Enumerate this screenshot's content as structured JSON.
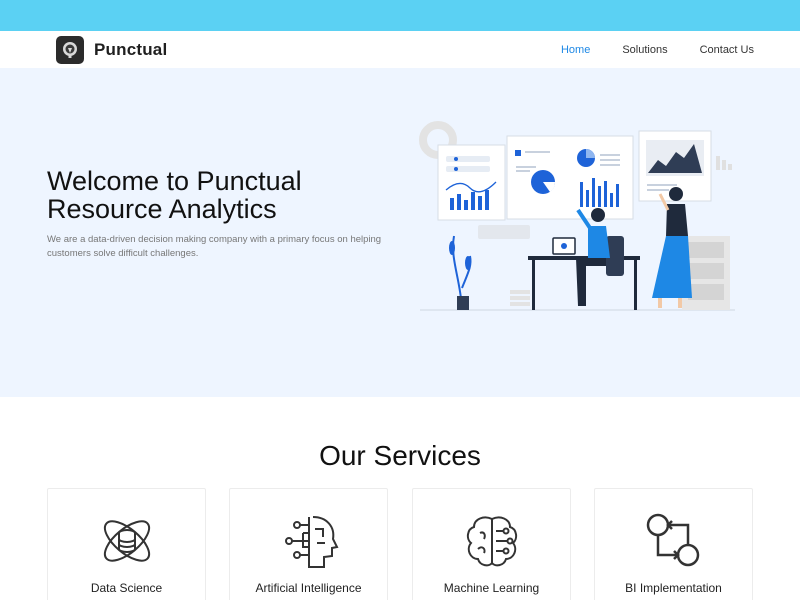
{
  "brand": {
    "name": "Punctual"
  },
  "nav": {
    "items": [
      "Home",
      "Solutions",
      "Contact Us"
    ],
    "active": "Home"
  },
  "hero": {
    "title": "Welcome to Punctual Resource Analytics",
    "subtitle": "We are a data-driven decision making company with a primary focus on helping customers solve difficult challenges."
  },
  "services": {
    "title": "Our Services",
    "items": [
      {
        "label": "Data Science",
        "icon": "data-science-icon"
      },
      {
        "label": "Artificial Intelligence",
        "icon": "ai-head-icon"
      },
      {
        "label": "Machine Learning",
        "icon": "brain-icon"
      },
      {
        "label": "BI Implementation",
        "icon": "workflow-icon"
      }
    ]
  },
  "colors": {
    "topbar": "#5bd1f3",
    "hero_bg": "#eef5ff",
    "accent": "#1e88e5"
  }
}
